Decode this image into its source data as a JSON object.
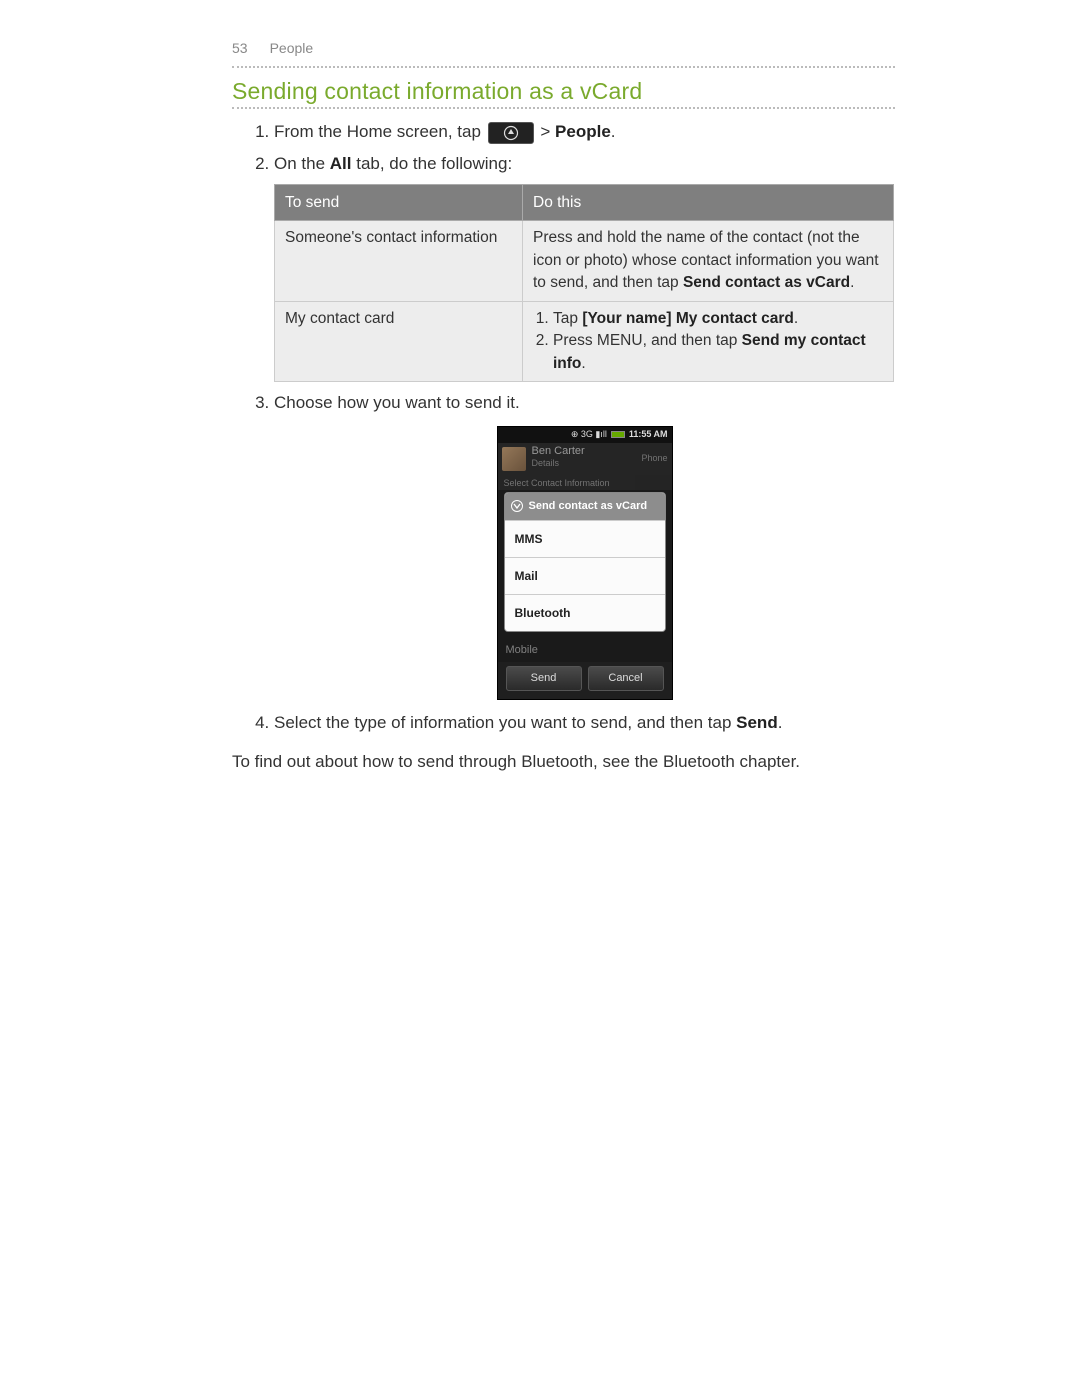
{
  "header": {
    "page_number": "53",
    "section": "People"
  },
  "section_title": "Sending contact information as a vCard",
  "steps": {
    "s1_prefix": "From the Home screen, tap ",
    "s1_suffix_sep": " > ",
    "s1_suffix_bold": "People",
    "s1_suffix_end": ".",
    "s2_prefix": "On the ",
    "s2_bold": "All",
    "s2_suffix": " tab, do the following:",
    "s3": "Choose how you want to send it.",
    "s4_prefix": "Select the type of information you want to send, and then tap ",
    "s4_bold": "Send",
    "s4_suffix": "."
  },
  "table": {
    "head_left": "To send",
    "head_right": "Do this",
    "rows": [
      {
        "left": "Someone's contact information",
        "right_prefix": "Press and hold the name of the contact (not the icon or photo) whose contact information you want to send, and then tap ",
        "right_bold": "Send contact as vCard",
        "right_suffix": "."
      },
      {
        "left": "My contact card",
        "sub1_prefix": "Tap ",
        "sub1_bold": "[Your name] My contact card",
        "sub1_suffix": ".",
        "sub2_prefix": "Press MENU, and then tap ",
        "sub2_bold": "Send my contact info",
        "sub2_suffix": "."
      }
    ]
  },
  "phone": {
    "status_icons": "⊕ 3G ▮ıll",
    "time": "11:55 AM",
    "contact_name": "Ben Carter",
    "contact_sub": "Details",
    "phone_tag": "Phone",
    "dim_caption": "Select Contact Information",
    "dialog_title": "Send contact as vCard",
    "options": [
      "MMS",
      "Mail",
      "Bluetooth"
    ],
    "below_label": "Mobile",
    "btn_send": "Send",
    "btn_cancel": "Cancel"
  },
  "closing": "To find out about how to send through Bluetooth, see the Bluetooth chapter.",
  "icons": {
    "apps_launcher": "apps-launcher-icon",
    "down_arrow": "chevron-down-icon"
  }
}
